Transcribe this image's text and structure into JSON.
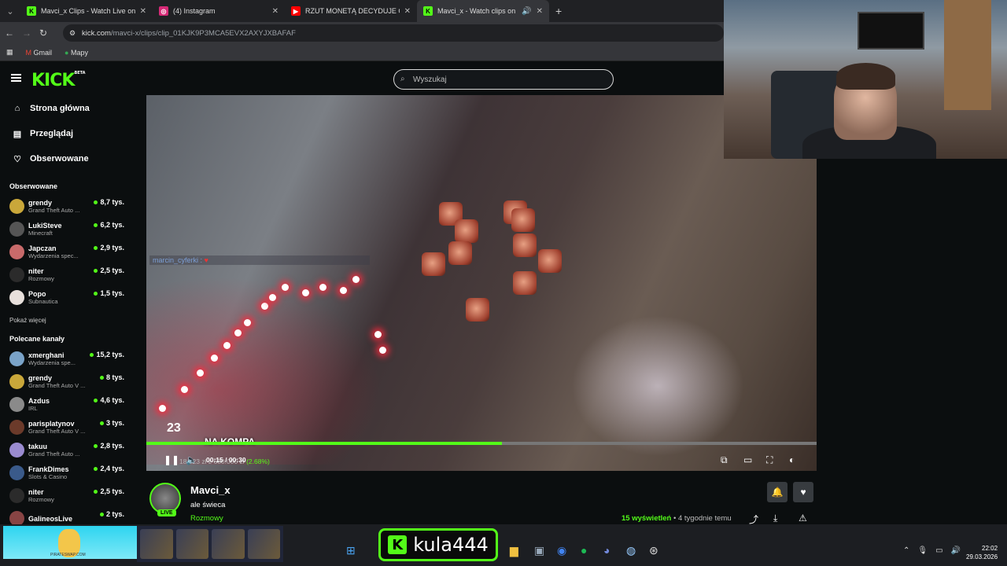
{
  "browser": {
    "tabs": [
      {
        "title": "Mavci_x Clips - Watch Live on K",
        "icon": "kick-icon",
        "color": "#53fc18"
      },
      {
        "title": "(4) Instagram",
        "icon": "instagram-icon",
        "color": "#d62976"
      },
      {
        "title": "RZUT MONETĄ DECYDUJE O N",
        "icon": "youtube-icon",
        "color": "#ff0000"
      },
      {
        "title": "Mavci_x - Watch clips on Ki",
        "icon": "kick-icon",
        "color": "#53fc18"
      }
    ],
    "url_host": "kick.com",
    "url_path": "/mavci-x/clips/clip_01KJK9P3MCA5EVX2AXYJXBAFAF",
    "bookmarks": [
      "Gmail",
      "Mapy"
    ]
  },
  "kick": {
    "logo": "KICK",
    "logo_beta": "BETA",
    "search_placeholder": "Wyszukaj",
    "nav": [
      "Strona główna",
      "Przeglądaj",
      "Obserwowane"
    ],
    "followed_header": "Obserwowane",
    "followed": [
      {
        "name": "grendy",
        "game": "Grand Theft Auto ...",
        "viewers": "8,7 tys.",
        "color": "#c9a73a"
      },
      {
        "name": "LukiSteve",
        "game": "Minecraft",
        "viewers": "6,2 tys.",
        "color": "#555"
      },
      {
        "name": "Japczan",
        "game": "Wydarzenia spec...",
        "viewers": "2,9 tys.",
        "color": "#c86a6a"
      },
      {
        "name": "niter",
        "game": "Rozmowy",
        "viewers": "2,5 tys.",
        "color": "#2b2b2b"
      },
      {
        "name": "Popo",
        "game": "Subnautica",
        "viewers": "1,5 tys.",
        "color": "#e8e0dc"
      }
    ],
    "show_more": "Pokaż więcej",
    "recommended_header": "Polecane kanały",
    "recommended": [
      {
        "name": "xmerghani",
        "game": "Wydarzenia spe...",
        "viewers": "15,2 tys.",
        "color": "#7aa3c8"
      },
      {
        "name": "grendy",
        "game": "Grand Theft Auto V ...",
        "viewers": "8 tys.",
        "color": "#c9a73a"
      },
      {
        "name": "Azdus",
        "game": "IRL",
        "viewers": "4,6 tys.",
        "color": "#8a8a8a"
      },
      {
        "name": "parisplatynov",
        "game": "Grand Theft Auto V ...",
        "viewers": "3 tys.",
        "color": "#6b3a2a"
      },
      {
        "name": "takuu",
        "game": "Grand Theft Auto ...",
        "viewers": "2,8 tys.",
        "color": "#9a8bd0"
      },
      {
        "name": "FrankDimes",
        "game": "Slots & Casino",
        "viewers": "2,4 tys.",
        "color": "#3a5a8a"
      },
      {
        "name": "niter",
        "game": "Rozmowy",
        "viewers": "2,5 tys.",
        "color": "#2b2b2b"
      },
      {
        "name": "GalineosLive",
        "game": "",
        "viewers": "2 tys.",
        "color": "#884444"
      }
    ]
  },
  "player": {
    "chat_line": "marcin_cyferki :",
    "count_badge": "23",
    "overlay_caption": "NA KOMPA",
    "time": "00:15 / 00:30",
    "overlay_stat_prefix": "18.523 zł z 680.000 zł",
    "overlay_stat_pct": "(2.68%)",
    "progress": 0.53
  },
  "clip": {
    "channel": "Mavci_x",
    "title": "ale świeca",
    "category": "Rozmowy",
    "live_label": "LIVE",
    "views": "15 wyświetleń",
    "age": "• 4 tygodnie temu"
  },
  "taskbar": {
    "thumb_label": "PIRATESWAP.COM",
    "overlay_name": "kula444",
    "time": "22:02",
    "date": "29.03.2026"
  }
}
